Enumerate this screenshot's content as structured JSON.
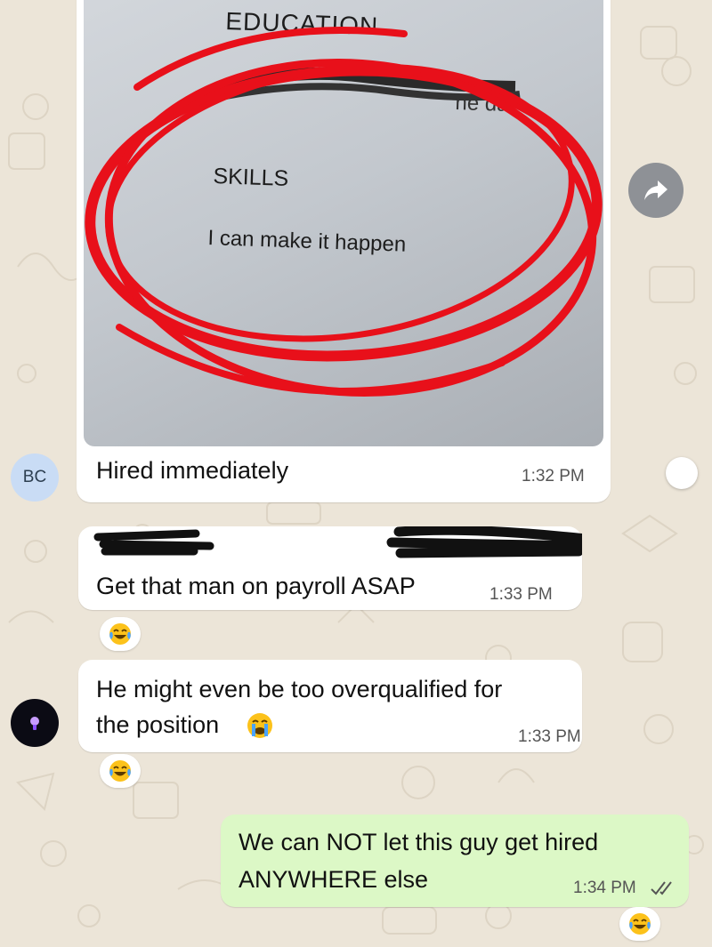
{
  "photo": {
    "heading": "EDUCATION",
    "school_fragment": "ne   da",
    "skills_heading": "SKILLS",
    "skills_text": "I can make it happen"
  },
  "messages": [
    {
      "sender_initials": "BC",
      "text": "Hired immediately",
      "time": "1:32 PM"
    },
    {
      "text": "Get that man on payroll ASAP",
      "time": "1:33 PM",
      "reaction": "laughing-tears-emoji"
    },
    {
      "text_line1": "He might even be too overqualified for",
      "text_line2": "the position",
      "time": "1:33 PM",
      "reaction": "laughing-tears-emoji"
    },
    {
      "text_line1": "We can NOT let this guy get hired",
      "text_line2": "ANYWHERE else",
      "time": "1:34 PM",
      "status": "read",
      "reaction": "laughing-tears-emoji"
    }
  ],
  "colors": {
    "wallpaper": "#ece5d8",
    "incoming_bubble": "#ffffff",
    "outgoing_bubble": "#dcf8c6",
    "annotation_circle": "#e8101a",
    "redaction": "#111111"
  },
  "icons": [
    "forward-icon",
    "double-check-icon",
    "crying-face-emoji",
    "laughing-tears-emoji"
  ]
}
